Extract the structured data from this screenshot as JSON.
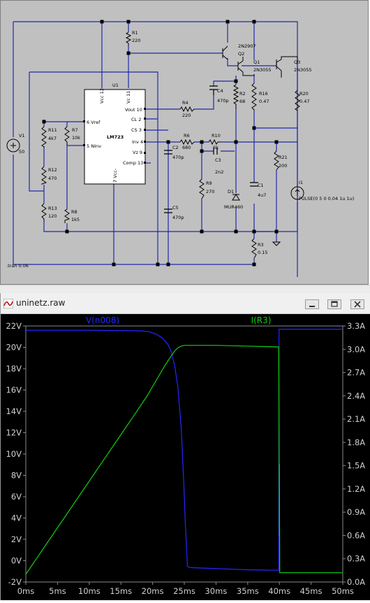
{
  "schematic": {
    "components": {
      "V1": {
        "name": "V1",
        "value": "50"
      },
      "R1": {
        "name": "R1",
        "value": "220"
      },
      "Q2": {
        "name": "Q2",
        "model": "2N2907"
      },
      "Q1": {
        "name": "Q1",
        "model": "2N3055"
      },
      "Q3": {
        "name": "Q3",
        "model": "2N3055"
      },
      "U1": {
        "name": "U1",
        "model": "LM723",
        "pins": {
          "vcc": "Vcc 12",
          "vc": "Vc 11",
          "vout": "Vout 10",
          "cl": "CL 2",
          "cs": "CS 3",
          "inv": "Inv 4",
          "vz": "Vz 9",
          "comp": "Comp 13",
          "vref": "6 Vref",
          "ninv": "5 NInv",
          "vee": "7 Vcc-"
        }
      },
      "R2": {
        "name": "R2",
        "value": "68"
      },
      "C4": {
        "name": "C4",
        "value": "470p"
      },
      "R16": {
        "name": "R16",
        "value": "0.47"
      },
      "R20": {
        "name": "R20",
        "value": "0.47"
      },
      "R4": {
        "name": "R4",
        "value": "220"
      },
      "R11": {
        "name": "R11",
        "value": "4k7"
      },
      "R7": {
        "name": "R7",
        "value": "10k"
      },
      "R6": {
        "name": "R6",
        "value": "680"
      },
      "R10": {
        "name": "R10",
        "value": "6k"
      },
      "C2": {
        "name": "C2",
        "value": "470p"
      },
      "C3": {
        "name": "C3",
        "value": "2n2"
      },
      "R21": {
        "name": "R21",
        "value": "200"
      },
      "R12": {
        "name": "R12",
        "value": "470"
      },
      "R9": {
        "name": "R9",
        "value": "270"
      },
      "D1": {
        "name": "D1",
        "model": "MUR460"
      },
      "C1": {
        "name": "C1",
        "value": "4u7"
      },
      "I1": {
        "name": "I1",
        "value": "PULSE(0 5 0 0.04 1u 1u)"
      },
      "R13": {
        "name": "R13",
        "value": "120"
      },
      "R8": {
        "name": "R8",
        "value": "1k5"
      },
      "C5": {
        "name": "C5",
        "value": "470p"
      },
      "R3": {
        "name": "R3",
        "value": "0.15"
      }
    },
    "directive": ".tran 0.06"
  },
  "window": {
    "title": "uninetz.raw"
  },
  "chart_data": {
    "type": "line",
    "x": [
      0,
      1,
      2,
      3,
      4,
      5,
      6,
      7,
      8,
      9,
      10,
      11,
      12,
      13,
      14,
      15,
      16,
      17,
      18,
      19,
      20,
      21,
      22,
      23,
      24,
      25,
      26,
      27,
      28,
      29,
      30,
      31,
      32,
      33,
      34,
      35,
      36,
      37,
      38,
      39,
      40,
      41,
      42,
      43,
      44,
      45,
      46,
      47,
      48,
      49,
      50
    ],
    "x_tick_labels": [
      "0ms",
      "5ms",
      "10ms",
      "15ms",
      "20ms",
      "25ms",
      "30ms",
      "35ms",
      "40ms",
      "45ms",
      "50ms"
    ],
    "x_ticks": [
      0,
      5,
      10,
      15,
      20,
      25,
      30,
      35,
      40,
      45,
      50
    ],
    "xlim": [
      0,
      50
    ],
    "y_left_tick_labels": [
      "-2V",
      "0V",
      "2V",
      "4V",
      "6V",
      "8V",
      "10V",
      "12V",
      "14V",
      "16V",
      "18V",
      "20V",
      "22V"
    ],
    "y_left_ticks": [
      -2,
      0,
      2,
      4,
      6,
      8,
      10,
      12,
      14,
      16,
      18,
      20,
      22
    ],
    "ylim_left": [
      -2,
      22
    ],
    "y_right_tick_labels": [
      "0.0A",
      "0.3A",
      "0.6A",
      "0.9A",
      "1.2A",
      "1.5A",
      "1.8A",
      "2.1A",
      "2.4A",
      "2.7A",
      "3.0A",
      "3.3A"
    ],
    "y_right_ticks": [
      0,
      0.3,
      0.6,
      0.9,
      1.2,
      1.5,
      1.8,
      2.1,
      2.4,
      2.7,
      3.0,
      3.3
    ],
    "ylim_right": [
      0,
      3.3
    ],
    "grid": false,
    "background": "#000000",
    "series": [
      {
        "name": "V(n008)",
        "axis": "left",
        "color": "#2626ff",
        "points": [
          [
            0,
            21.6
          ],
          [
            10,
            21.6
          ],
          [
            18,
            21.55
          ],
          [
            19.5,
            21.45
          ],
          [
            20.5,
            21.25
          ],
          [
            21.5,
            20.9
          ],
          [
            22.5,
            20.2
          ],
          [
            23,
            19.5
          ],
          [
            23.5,
            18.2
          ],
          [
            24,
            16.2
          ],
          [
            24.5,
            12.5
          ],
          [
            24.9,
            7.5
          ],
          [
            25.2,
            3.0
          ],
          [
            25.5,
            -0.55
          ],
          [
            26,
            -0.65
          ],
          [
            30,
            -0.75
          ],
          [
            35,
            -0.85
          ],
          [
            39.5,
            -0.9
          ],
          [
            39.9,
            -0.9
          ],
          [
            39.95,
            21.7
          ],
          [
            50,
            21.7
          ]
        ]
      },
      {
        "name": "I(R3)",
        "axis": "right",
        "color": "#10d010",
        "points": [
          [
            0,
            0.1
          ],
          [
            1,
            0.22
          ],
          [
            2,
            0.34
          ],
          [
            3,
            0.46
          ],
          [
            4,
            0.58
          ],
          [
            5,
            0.7
          ],
          [
            6,
            0.82
          ],
          [
            7,
            0.94
          ],
          [
            8,
            1.06
          ],
          [
            9,
            1.18
          ],
          [
            10,
            1.3
          ],
          [
            11,
            1.42
          ],
          [
            12,
            1.54
          ],
          [
            13,
            1.66
          ],
          [
            14,
            1.78
          ],
          [
            15,
            1.9
          ],
          [
            16,
            2.02
          ],
          [
            17,
            2.14
          ],
          [
            18,
            2.26
          ],
          [
            19,
            2.38
          ],
          [
            20,
            2.52
          ],
          [
            21,
            2.66
          ],
          [
            22,
            2.8
          ],
          [
            23,
            2.92
          ],
          [
            23.5,
            2.98
          ],
          [
            24,
            3.02
          ],
          [
            24.5,
            3.04
          ],
          [
            25,
            3.05
          ],
          [
            30,
            3.05
          ],
          [
            35,
            3.04
          ],
          [
            39.5,
            3.03
          ],
          [
            39.9,
            3.03
          ],
          [
            40,
            0.6
          ],
          [
            40,
            1.52
          ],
          [
            40.05,
            0.12
          ],
          [
            50,
            0.12
          ]
        ]
      }
    ]
  }
}
